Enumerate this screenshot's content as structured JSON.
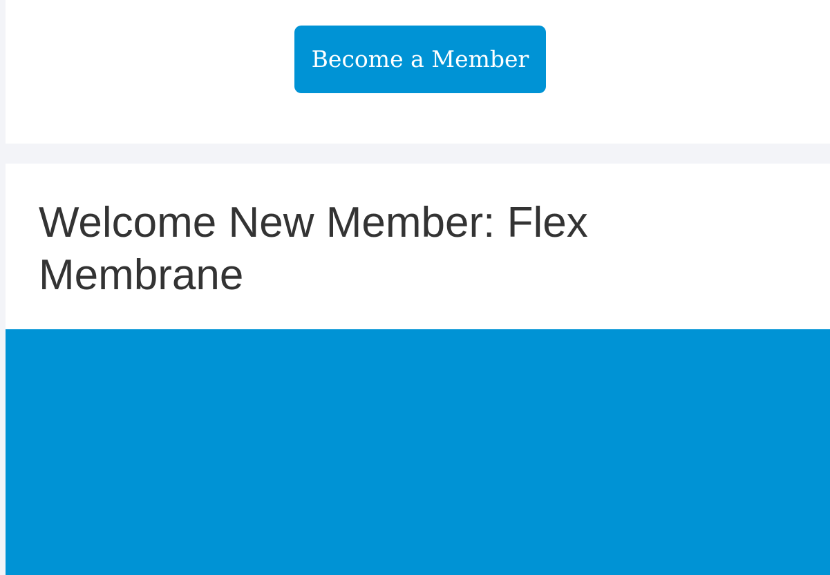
{
  "header": {
    "cta_label": "Become a Member"
  },
  "post": {
    "title": "Welcome New Member: Flex Membrane"
  },
  "colors": {
    "brand_blue": "#0093d5",
    "page_background": "#f3f4f8",
    "card_background": "#ffffff",
    "title_text": "#333333"
  }
}
